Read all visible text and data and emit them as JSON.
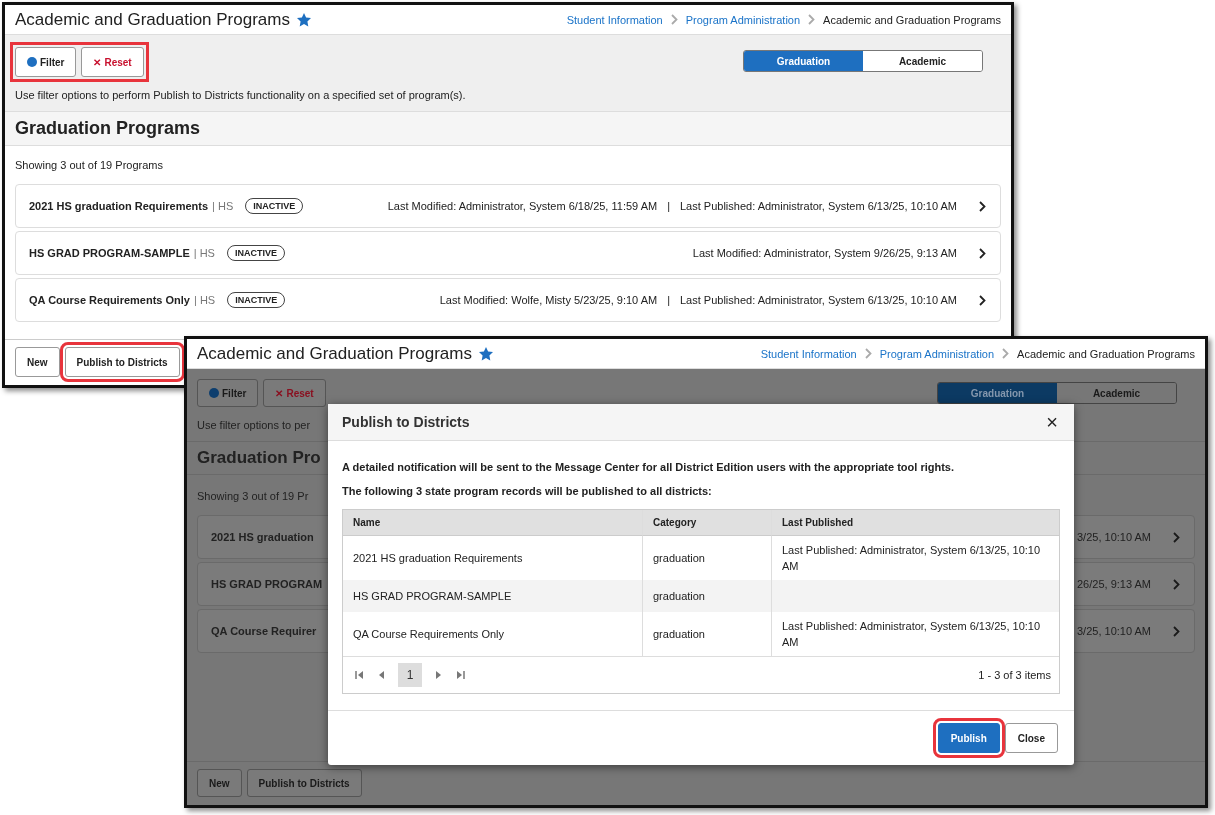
{
  "windows": [
    {
      "title": "Academic and Graduation Programs",
      "favorite": true,
      "dimmed": false,
      "breadcrumb": [
        {
          "label": "Student Information",
          "link": true
        },
        {
          "label": "Program Administration",
          "link": true
        },
        {
          "label": "Academic and Graduation Programs",
          "link": false
        }
      ],
      "toolbar": {
        "filter": "Filter",
        "reset_icon": "✕",
        "reset": "Reset",
        "highlighted": true
      },
      "view_tabs": [
        {
          "label": "Graduation",
          "selected": true
        },
        {
          "label": "Academic",
          "selected": false
        }
      ],
      "hint": "Use filter options to perform Publish to Districts functionality on a specified set of program(s).",
      "section_title": "Graduation Programs",
      "count_text": "Showing 3 out of 19 Programs",
      "programs": [
        {
          "name": "2021 HS graduation Requirements",
          "grade": "| HS",
          "status": "INACTIVE",
          "meta": [
            "Last Modified: Administrator, System 6/18/25, 11:59 AM",
            "|",
            "Last Published: Administrator, System 6/13/25, 10:10 AM"
          ]
        },
        {
          "name": "HS GRAD PROGRAM-SAMPLE",
          "grade": "| HS",
          "status": "INACTIVE",
          "meta": [
            "Last Modified: Administrator, System 9/26/25, 9:13 AM"
          ]
        },
        {
          "name": "QA Course Requirements Only",
          "grade": "| HS",
          "status": "INACTIVE",
          "meta": [
            "Last Modified: Wolfe, Misty 5/23/25, 9:10 AM",
            "|",
            "Last Published: Administrator, System 6/13/25, 10:10 AM"
          ]
        }
      ],
      "footer_buttons": [
        {
          "label": "New",
          "highlighted": false
        },
        {
          "label": "Publish to Districts",
          "highlighted": true
        }
      ]
    },
    {
      "title": "Academic and Graduation Programs",
      "favorite": true,
      "dimmed": true,
      "breadcrumb": [
        {
          "label": "Student Information",
          "link": true
        },
        {
          "label": "Program Administration",
          "link": true
        },
        {
          "label": "Academic and Graduation Programs",
          "link": false
        }
      ],
      "toolbar": {
        "filter": "Filter",
        "reset_icon": "✕",
        "reset": "Reset"
      },
      "view_tabs": [
        {
          "label": "Graduation",
          "selected": true
        },
        {
          "label": "Academic",
          "selected": false
        }
      ],
      "hint": "Use filter options to per",
      "section_title": "Graduation Pro",
      "count_text": "Showing 3 out of 19 Pr",
      "programs": [
        {
          "name": "2021 HS graduation",
          "meta": [
            "3/25, 10:10 AM"
          ]
        },
        {
          "name": "HS GRAD PROGRAM",
          "meta": [
            "26/25, 9:13 AM"
          ]
        },
        {
          "name": "QA Course Requirer",
          "meta": [
            "3/25, 10:10 AM"
          ]
        }
      ],
      "footer_buttons": [
        {
          "label": "New",
          "highlighted": false
        },
        {
          "label": "Publish to Districts",
          "highlighted": false
        }
      ],
      "modal": {
        "title": "Publish to Districts",
        "close": "×",
        "notes": [
          "A detailed notification will be sent to the Message Center for all District Edition users with the appropriate tool rights.",
          "The following 3 state program records will be published to all districts:"
        ],
        "columns": [
          "Name",
          "Category",
          "Last Published"
        ],
        "rows": [
          [
            "2021 HS graduation Requirements",
            "graduation",
            "Last Published: Administrator, System 6/13/25, 10:10 AM"
          ],
          [
            "HS GRAD PROGRAM-SAMPLE",
            "graduation",
            ""
          ],
          [
            "QA Course Requirements Only",
            "graduation",
            "Last Published: Administrator, System 6/13/25, 10:10 AM"
          ]
        ],
        "pages": [
          {
            "label": "1",
            "selected": true
          }
        ],
        "summary": "1 - 3 of 3 items",
        "buttons": [
          {
            "label": "Publish",
            "kind": "primary",
            "highlighted": true
          },
          {
            "label": "Close",
            "kind": "secondary",
            "highlighted": false
          }
        ]
      }
    }
  ]
}
